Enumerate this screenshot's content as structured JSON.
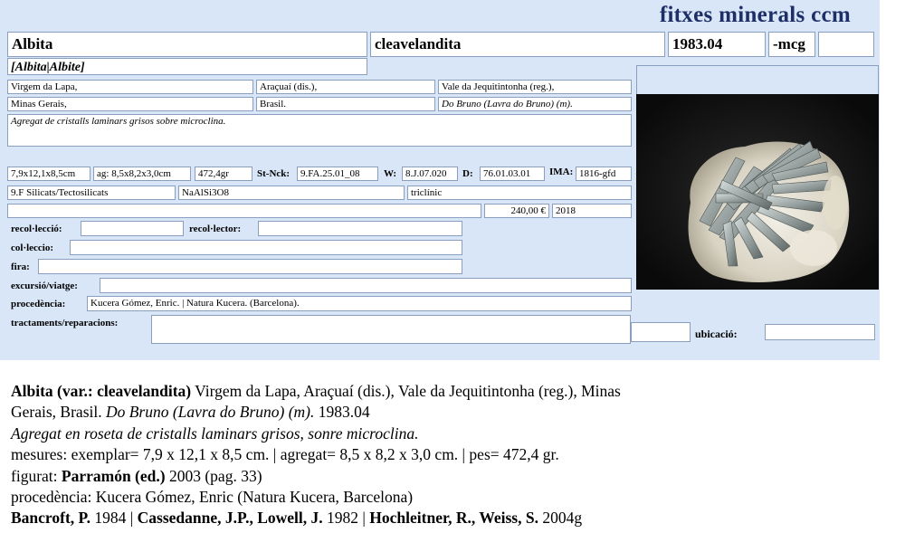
{
  "header": {
    "title": "fitxes minerals ccm"
  },
  "record": {
    "species": "Albita",
    "variety": "cleavelandita",
    "catalog_no": "1983.04",
    "collector_code": "-mcg",
    "synonym": "[Albita|Albite]",
    "locality": "Virgem da Lapa,",
    "district": "Araçuaí (dis.),",
    "region": "Vale da Jequitintonha (reg.),",
    "state": "Minas Gerais,",
    "country": "Brasil.",
    "mine": "Do Bruno (Lavra do Bruno) (m).",
    "description": "Agregat de cristalls laminars grisos sobre microclina.",
    "size_specimen": "7,9x12,1x8,5cm",
    "size_aggregate": "ag: 8,5x8,2x3,0cm",
    "weight": "472,4gr",
    "strunz_label": "St-Nck:",
    "strunz": "9.FA.25.01_08",
    "w_label": "W:",
    "w_value": "8.J.07.020",
    "d_label": "D:",
    "d_value": "76.01.03.01",
    "ima_label": "IMA:",
    "ima_value": "1816-gfd",
    "class": "9.F Silicats/Tectosilicats",
    "formula": "NaAlSi3O8",
    "crystal_system": "triclínic",
    "price": "240,00 €",
    "year": "2018",
    "labels": {
      "recol_leccio": "recol·lecció:",
      "recol_lector": "recol·lector:",
      "col_leccio": "col·leccio:",
      "fira": "fira:",
      "excursio": "excursió/viatge:",
      "procedencia": "procedència:",
      "tractaments": "tractaments/reparacions:",
      "ubicacio": "ubicació:"
    },
    "procedencia_value": "Kucera Gómez, Enric. | Natura Kucera. (Barcelona)."
  },
  "caption": {
    "l1_bold": "Albita (var.: cleavelandita)",
    "l1_rest": " Virgem da Lapa, Araçuaí (dis.), Vale da Jequitintonha (reg.), Minas",
    "l2_a": "Gerais, Brasil. ",
    "l2_italic": "Do Bruno (Lavra do Bruno) (m).",
    "l2_b": " 1983.04",
    "l3_italic": "Agregat en roseta de cristalls laminars grisos, sonre microclina.",
    "l4": "mesures: exemplar= 7,9 x 12,1 x 8,5 cm. | agregat= 8,5 x 8,2 x 3,0 cm. | pes= 472,4 gr.",
    "l5_a": "figurat: ",
    "l5_bold": "Parramón (ed.)",
    "l5_b": " 2003 (pag. 33)",
    "l6": "procedència: Kucera Gómez, Enric (Natura Kucera, Barcelona)",
    "l7_b1": "Bancroft, P.",
    "l7_t1": " 1984 | ",
    "l7_b2": "Cassedanne, J.P., Lowell, J.",
    "l7_t2": " 1982 | ",
    "l7_b3": "Hochleitner, R., Weiss, S.",
    "l7_t3": " 2004g"
  },
  "photo": {
    "subject": "grey bladed albite rosette on white microcline"
  }
}
